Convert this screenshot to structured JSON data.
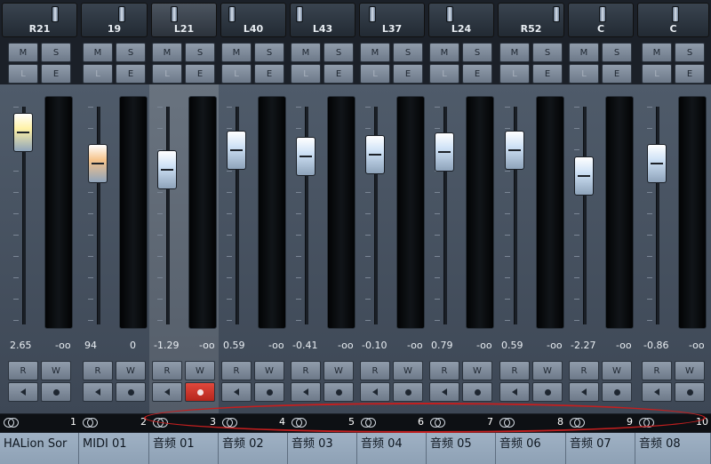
{
  "mixer": {
    "channels": [
      {
        "number": "1",
        "name": "HALion Sor",
        "pan": "R21",
        "pan_pos": 0.71,
        "volume": "2.65",
        "meter": "-oo",
        "fader": 0.88,
        "cap_color": "#fff2a6",
        "selected": false,
        "midi": false,
        "record": false
      },
      {
        "number": "2",
        "name": "MIDI 01",
        "pan": "19",
        "pan_pos": 0.6,
        "volume": "94",
        "meter": "0",
        "fader": 0.74,
        "cap_color": "#f6c48c",
        "selected": false,
        "midi": true,
        "record": false
      },
      {
        "number": "3",
        "name": "音频 01",
        "pan": "L21",
        "pan_pos": 0.29,
        "volume": "-1.29",
        "meter": "-oo",
        "fader": 0.71,
        "cap_color": "#cfe2f6",
        "selected": true,
        "midi": false,
        "record": true
      },
      {
        "number": "4",
        "name": "音频 02",
        "pan": "L40",
        "pan_pos": 0.1,
        "volume": "0.59",
        "meter": "-oo",
        "fader": 0.8,
        "cap_color": "#cfe2f6",
        "selected": false,
        "midi": false,
        "record": false
      },
      {
        "number": "5",
        "name": "音频 03",
        "pan": "L43",
        "pan_pos": 0.07,
        "volume": "-0.41",
        "meter": "-oo",
        "fader": 0.77,
        "cap_color": "#cfe2f6",
        "selected": false,
        "midi": false,
        "record": false
      },
      {
        "number": "6",
        "name": "音频 04",
        "pan": "L37",
        "pan_pos": 0.13,
        "volume": "-0.10",
        "meter": "-oo",
        "fader": 0.78,
        "cap_color": "#cfe2f6",
        "selected": false,
        "midi": false,
        "record": false
      },
      {
        "number": "7",
        "name": "音频 05",
        "pan": "L24",
        "pan_pos": 0.26,
        "volume": "0.79",
        "meter": "-oo",
        "fader": 0.79,
        "cap_color": "#cfe2f6",
        "selected": false,
        "midi": false,
        "record": false
      },
      {
        "number": "8",
        "name": "音频 06",
        "pan": "R52",
        "pan_pos": 0.9,
        "volume": "0.59",
        "meter": "-oo",
        "fader": 0.8,
        "cap_color": "#cfe2f6",
        "selected": false,
        "midi": false,
        "record": false
      },
      {
        "number": "9",
        "name": "音频 07",
        "pan": "C",
        "pan_pos": 0.5,
        "volume": "-2.27",
        "meter": "-oo",
        "fader": 0.68,
        "cap_color": "#cfe2f6",
        "selected": false,
        "midi": false,
        "record": false
      },
      {
        "number": "10",
        "name": "音频 08",
        "pan": "C",
        "pan_pos": 0.5,
        "volume": "-0.86",
        "meter": "-oo",
        "fader": 0.74,
        "cap_color": "#cfe2f6",
        "selected": false,
        "midi": false,
        "record": false
      }
    ],
    "buttons": {
      "mute": "M",
      "solo": "S",
      "listen": "L",
      "edit": "E",
      "read": "R",
      "write": "W"
    },
    "icons": {
      "monitor": "speaker-icon",
      "record": "record-dot-icon",
      "link": "stereo-link-icon"
    },
    "annotation_color": "#c41f1f",
    "record_active_color": "#e0483c"
  }
}
